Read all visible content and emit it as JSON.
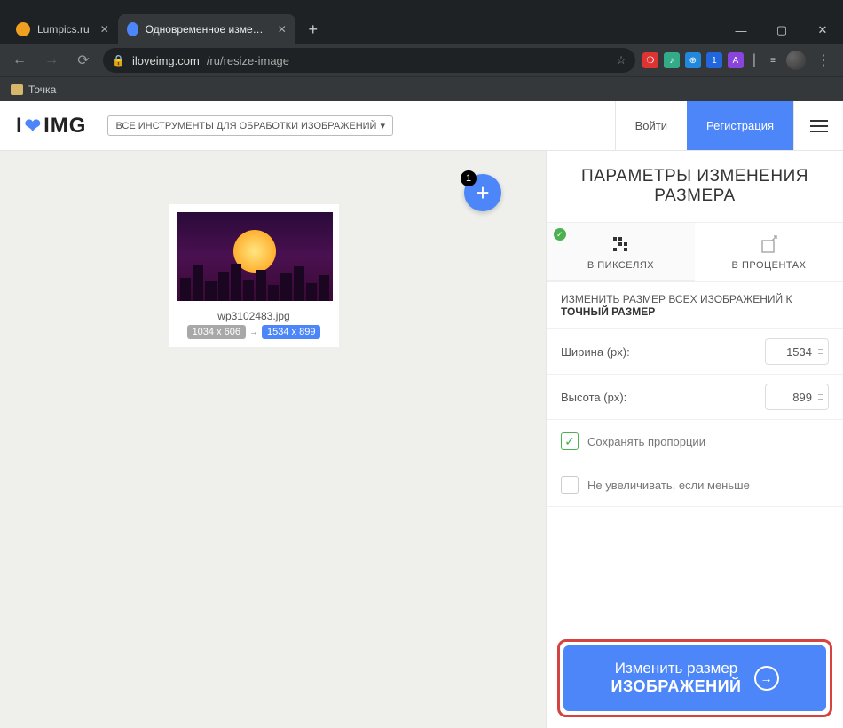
{
  "browser": {
    "tabs": [
      {
        "title": "Lumpics.ru",
        "active": false
      },
      {
        "title": "Одновременное изменение ра",
        "active": true
      }
    ],
    "url_host": "iloveimg.com",
    "url_path": "/ru/resize-image",
    "bookmark": "Точка"
  },
  "header": {
    "logo_pre": "I",
    "logo_post": "IMG",
    "tools_menu": "ВСЕ ИНСТРУМЕНТЫ ДЛЯ ОБРАБОТКИ ИЗОБРАЖЕНИЙ",
    "login": "Войти",
    "register": "Регистрация"
  },
  "canvas": {
    "add_count": "1",
    "file": {
      "name": "wp3102483.jpg",
      "old_dim": "1034 x 606",
      "new_dim": "1534 x 899"
    }
  },
  "sidebar": {
    "title": "ПАРАМЕТРЫ ИЗМЕНЕНИЯ РАЗМЕРА",
    "tab_pixels": "В ПИКСЕЛЯХ",
    "tab_percent": "В ПРОЦЕНТАХ",
    "section_lead": "ИЗМЕНИТЬ РАЗМЕР ВСЕХ ИЗОБРАЖЕНИЙ К",
    "section_strong": "ТОЧНЫЙ РАЗМЕР",
    "width_label": "Ширина (px):",
    "width_value": "1534",
    "height_label": "Высота (px):",
    "height_value": "899",
    "keep_aspect": "Сохранять пропорции",
    "no_upscale": "Не увеличивать, если меньше",
    "cta_line1": "Изменить размер",
    "cta_line2": "ИЗОБРАЖЕНИЙ"
  }
}
